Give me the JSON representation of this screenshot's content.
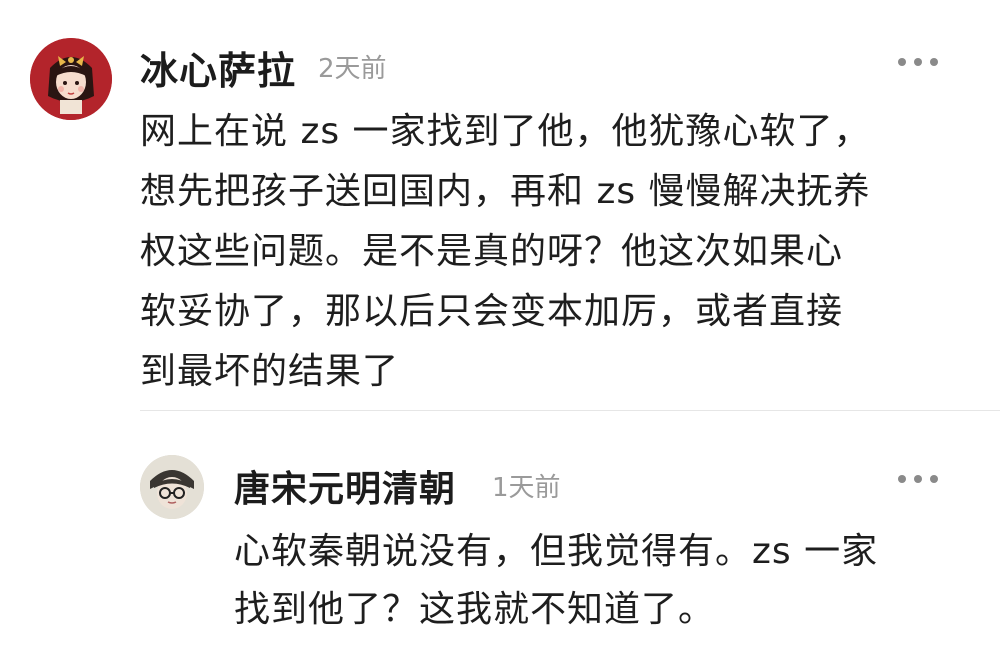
{
  "comment": {
    "author": "冰心萨拉",
    "time": "2天前",
    "lines": [
      "网上在说 zs 一家找到了他，他犹豫心软了，",
      "想先把孩子送回国内，再和 zs 慢慢解决抚养",
      "权这些问题。是不是真的呀？他这次如果心",
      "软妥协了，那以后只会变本加厉，或者直接",
      "到最坏的结果了"
    ],
    "avatar_icon": "girl-avatar-icon",
    "more_icon": "more-dots-icon"
  },
  "reply": {
    "author": "唐宋元明清朝",
    "time": "1天前",
    "lines": [
      "心软秦朝说没有，但我觉得有。zs 一家",
      "找到他了？这我就不知道了。"
    ],
    "avatar_icon": "person-glasses-avatar-icon",
    "more_icon": "more-dots-icon"
  }
}
